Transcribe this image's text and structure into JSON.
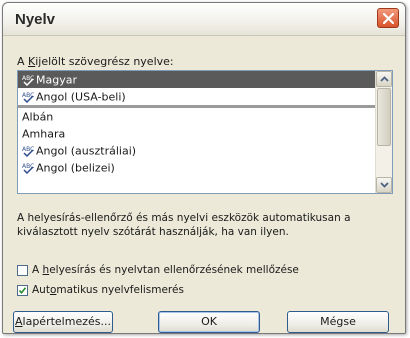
{
  "dialog": {
    "title": "Nyelv"
  },
  "prompt": {
    "accel": "K",
    "rest": "ijelölt szövegrész nyelve:",
    "prefix": "A "
  },
  "languages": [
    {
      "label": "Magyar",
      "spell": true,
      "selected": true
    },
    {
      "label": "Angol (USA-beli)",
      "spell": true,
      "selected": false
    },
    {
      "label": "Albán",
      "spell": false,
      "selected": false
    },
    {
      "label": "Amhara",
      "spell": false,
      "selected": false
    },
    {
      "label": "Angol (ausztráliai)",
      "spell": true,
      "selected": false
    },
    {
      "label": "Angol (belizei)",
      "spell": true,
      "selected": false
    }
  ],
  "info_text": "A helyesírás-ellenőrző és más nyelvi eszközök automatikusan a kiválasztott nyelv szótárát használják, ha van ilyen.",
  "options": {
    "skip_check": {
      "prefix": "A ",
      "accel": "h",
      "rest": "elyesírás és nyelvtan ellenőrzésének mellőzése",
      "checked": false
    },
    "auto_detect": {
      "prefix": "Aut",
      "accel": "o",
      "rest": "matikus nyelvfelismerés",
      "checked": true
    }
  },
  "buttons": {
    "default": {
      "accel": "A",
      "rest": "lapértelmezés..."
    },
    "ok": "OK",
    "cancel": "Mégse"
  },
  "colors": {
    "selection": "#5a5a5a",
    "close_button": "#d9532b",
    "spell_icon": "#2f4f8f"
  }
}
